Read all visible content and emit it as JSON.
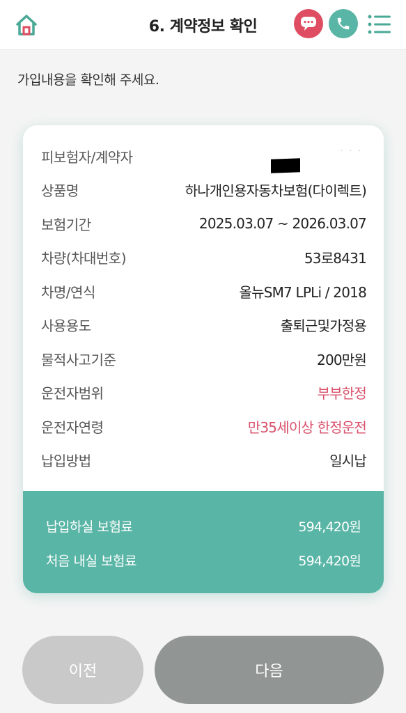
{
  "header": {
    "title": "6. 계약정보 확인",
    "accent_red": "#df4d62",
    "accent_teal": "#59b5a5"
  },
  "guide_text": "가입내용을 확인해 주세요.",
  "contract": {
    "rows": [
      {
        "label": "피보험자/계약자",
        "value": ""
      },
      {
        "label": "상품명",
        "value": "하나개인용자동차보험(다이렉트)"
      },
      {
        "label": "보험기간",
        "value": "2025.03.07 ~ 2026.03.07"
      },
      {
        "label": "차량(차대번호)",
        "value": "53로8431"
      },
      {
        "label": "차명/연식",
        "value": "올뉴SM7 LPLi / 2018"
      },
      {
        "label": "사용용도",
        "value": "출퇴근및가정용"
      },
      {
        "label": "물적사고기준",
        "value": "200만원"
      },
      {
        "label": "운전자범위",
        "value": "부부한정"
      },
      {
        "label": "운전자연령",
        "value": "만35세이상 한정운전"
      },
      {
        "label": "납입방법",
        "value": "일시납"
      }
    ]
  },
  "premium": {
    "pay_label": "납입하실 보험료",
    "pay_value": "594,420원",
    "first_label": "처음 내실 보험료",
    "first_value": "594,420원"
  },
  "buttons": {
    "prev": "이전",
    "next": "다음"
  }
}
